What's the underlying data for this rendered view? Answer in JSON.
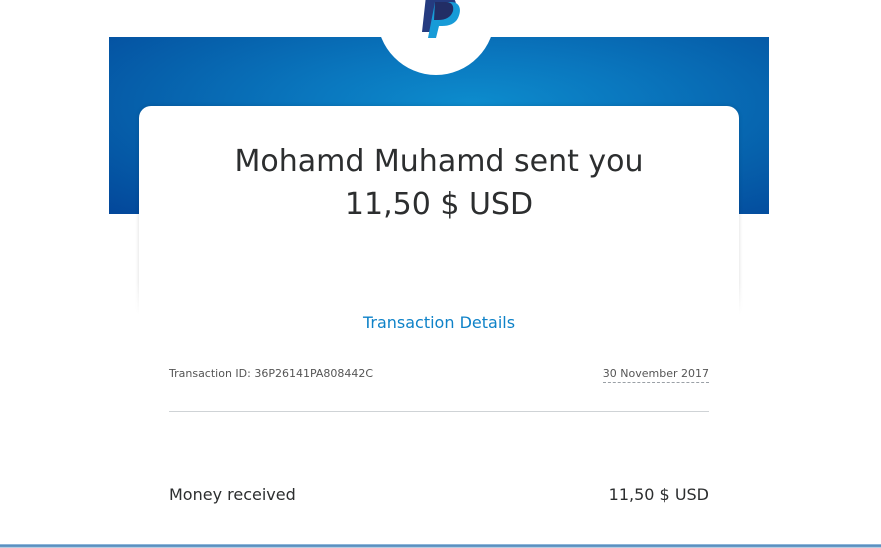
{
  "email": {
    "brand_logo": "paypal-logo",
    "headline_line1": "Mohamd Muhamd sent you",
    "headline_line2": "11,50 $ USD",
    "transaction_details_link": "Transaction Details",
    "transaction_id": "Transaction ID: 36P26141PA808442C",
    "date": "30 November 2017",
    "money_received_label": "Money received",
    "money_received_value": "11,50 $ USD"
  },
  "colors": {
    "brand_blue_dark": "#03479a",
    "brand_blue_light": "#0d8ccd",
    "link_blue": "#0e82c8",
    "text_dark": "#2c2e2f"
  }
}
